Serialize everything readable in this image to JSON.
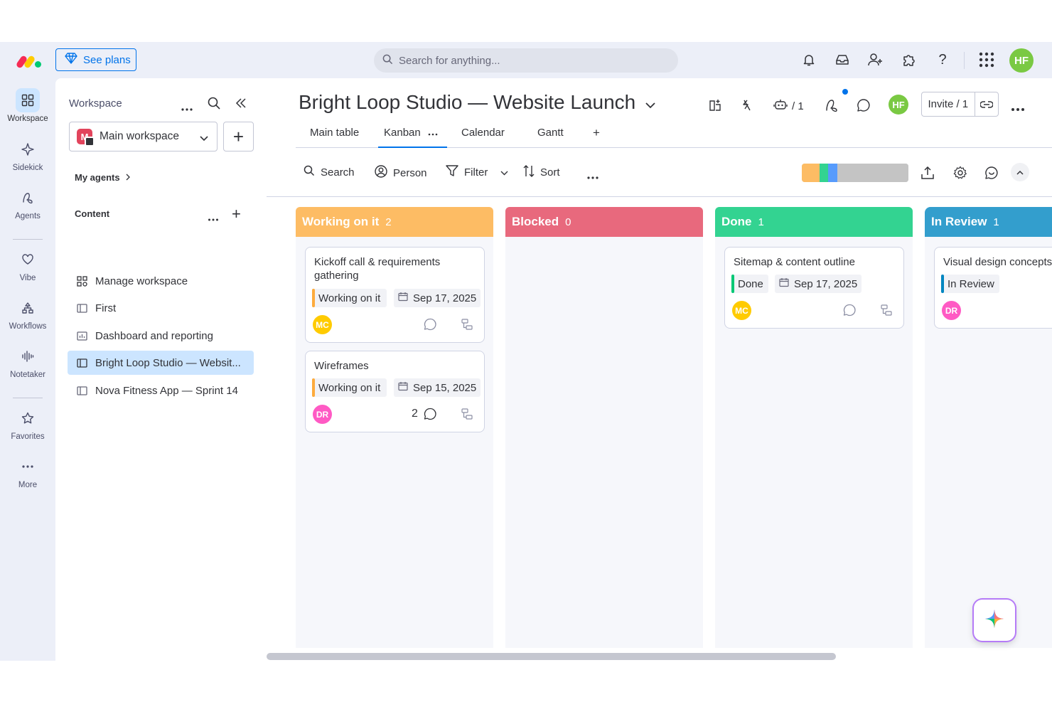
{
  "topbar": {
    "see_plans_label": "See plans",
    "search_placeholder": "Search for anything...",
    "user_initials": "HF"
  },
  "rail": {
    "items": [
      {
        "label": "Workspace",
        "icon": "grid-icon"
      },
      {
        "label": "Sidekick",
        "icon": "sparkle-icon"
      },
      {
        "label": "Agents",
        "icon": "agent-icon"
      },
      {
        "label": "Vibe",
        "icon": "heart-icon"
      },
      {
        "label": "Workflows",
        "icon": "workflow-icon"
      },
      {
        "label": "Notetaker",
        "icon": "waveform-icon"
      },
      {
        "label": "Favorites",
        "icon": "star-icon"
      },
      {
        "label": "More",
        "icon": "more-icon"
      }
    ]
  },
  "sidebar": {
    "title": "Workspace",
    "workspace_name": "Main workspace",
    "workspace_badge": "M",
    "my_agents_label": "My agents",
    "content_label": "Content",
    "items": [
      {
        "label": "Manage workspace",
        "icon": "manage-icon"
      },
      {
        "label": "First",
        "icon": "board-icon"
      },
      {
        "label": "Dashboard and reporting",
        "icon": "dashboard-icon"
      },
      {
        "label": "Bright Loop Studio — Websit...",
        "icon": "board-icon"
      },
      {
        "label": "Nova Fitness App — Sprint 14",
        "icon": "board-icon"
      }
    ]
  },
  "board": {
    "title": "Bright Loop Studio — Website Launch",
    "automation_count": "/ 1",
    "owner_initials": "HF",
    "invite_label": "Invite / 1",
    "tabs": [
      "Main table",
      "Kanban",
      "Calendar",
      "Gantt"
    ],
    "add_tab": "+",
    "toolbar": {
      "search": "Search",
      "person": "Person",
      "filter": "Filter",
      "sort": "Sort"
    },
    "progress": [
      {
        "color": "#fdbc64",
        "fraction": 0.167
      },
      {
        "color": "#33d391",
        "fraction": 0.083
      },
      {
        "color": "#579bfc",
        "fraction": 0.083
      },
      {
        "color": "#c4c4c4",
        "fraction": 0.667
      }
    ]
  },
  "columns": [
    {
      "name": "Working on it",
      "count": "2",
      "color": "#fdbc64",
      "cards": [
        {
          "title": "Kickoff call & requirements gathering",
          "status": "Working on it",
          "status_color": "#fdab3d",
          "date": "Sep 17, 2025",
          "assignee": "MC",
          "assignee_color": "#ffcb00",
          "comments": ""
        },
        {
          "title": "Wireframes",
          "status": "Working on it",
          "status_color": "#fdab3d",
          "date": "Sep 15, 2025",
          "assignee": "DR",
          "assignee_color": "#ff5ac4",
          "comments": "2"
        }
      ]
    },
    {
      "name": "Blocked",
      "count": "0",
      "color": "#e8697d",
      "cards": []
    },
    {
      "name": "Done",
      "count": "1",
      "color": "#33d391",
      "cards": [
        {
          "title": "Sitemap & content outline",
          "status": "Done",
          "status_color": "#00c875",
          "date": "Sep 17, 2025",
          "assignee": "MC",
          "assignee_color": "#ffcb00",
          "comments": ""
        }
      ]
    },
    {
      "name": "In Review",
      "count": "1",
      "color": "#339ecd",
      "cards": [
        {
          "title": "Visual design concepts",
          "status": "In Review",
          "status_color": "#0086c0",
          "date": "",
          "assignee": "DR",
          "assignee_color": "#ff5ac4",
          "comments": ""
        }
      ]
    }
  ]
}
